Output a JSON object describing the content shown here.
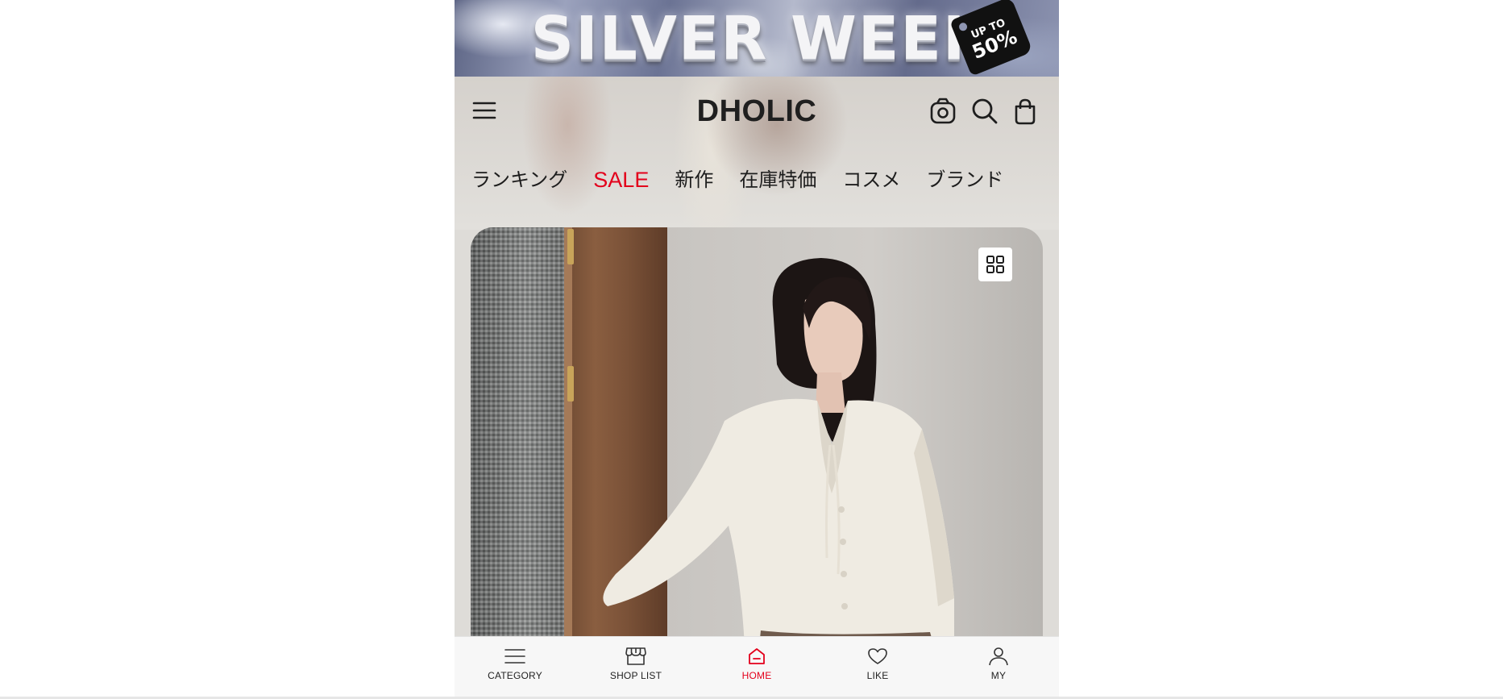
{
  "banner": {
    "title": "SILVER WEEK",
    "tag_up": "UP TO",
    "tag_percent": "50%"
  },
  "header": {
    "logo": "DHOLIC",
    "icons": [
      "hamburger-menu-icon",
      "camera-icon",
      "search-icon",
      "shopping-bag-icon"
    ]
  },
  "nav": {
    "items": [
      "ランキング",
      "SALE",
      "新作",
      "在庫特価",
      "コスメ",
      "ブランド"
    ]
  },
  "hero": {
    "grid_icon": "grid-view-icon"
  },
  "bottom_nav": {
    "items": [
      {
        "label": "CATEGORY",
        "icon": "category-list-icon"
      },
      {
        "label": "SHOP LIST",
        "icon": "storefront-icon"
      },
      {
        "label": "HOME",
        "icon": "home-icon"
      },
      {
        "label": "LIKE",
        "icon": "heart-icon"
      },
      {
        "label": "MY",
        "icon": "user-icon"
      }
    ],
    "active": "HOME",
    "active_color": "#e3001b"
  },
  "colors": {
    "sale": "#e3001b",
    "text": "#1d1d1d"
  }
}
